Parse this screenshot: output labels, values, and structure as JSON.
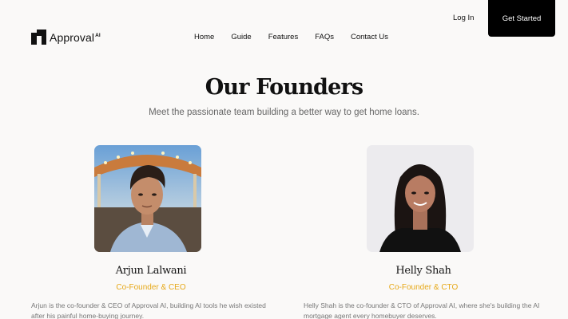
{
  "header": {
    "logo_text": "Approval",
    "logo_sup": "AI",
    "login_label": "Log In",
    "cta_label": "Get Started",
    "nav": [
      {
        "label": "Home"
      },
      {
        "label": "Guide"
      },
      {
        "label": "Features"
      },
      {
        "label": "FAQs"
      },
      {
        "label": "Contact Us"
      }
    ]
  },
  "hero": {
    "title": "Our Founders",
    "subtitle": "Meet the passionate team building a better way to get home loans."
  },
  "founders": [
    {
      "name": "Arjun Lalwani",
      "role": "Co-Founder & CEO",
      "bio": "Arjun is the co-founder & CEO of Approval AI, building AI tools he wish existed after his painful home-buying journey."
    },
    {
      "name": "Helly Shah",
      "role": "Co-Founder & CTO",
      "bio": "Helly Shah is the co-founder & CTO of Approval AI, where she's building the AI mortgage agent every homebuyer deserves."
    }
  ],
  "colors": {
    "accent": "#e6a817",
    "cta_bg": "#000000",
    "page_bg": "#faf9f8"
  }
}
